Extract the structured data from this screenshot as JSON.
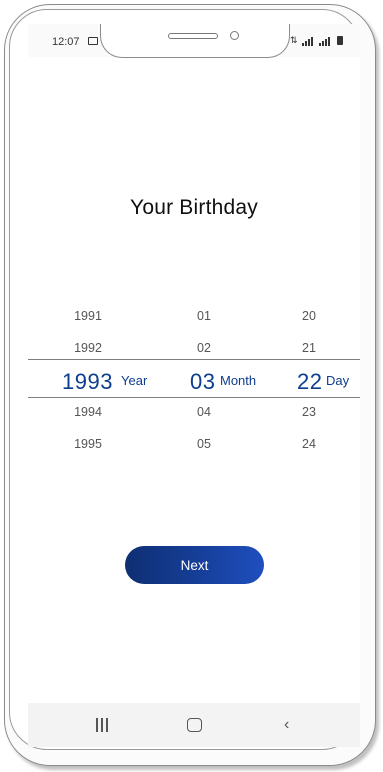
{
  "status_bar": {
    "time": "12:07",
    "icons": [
      "gallery-icon",
      "data-icon",
      "signal-icon",
      "signal-icon",
      "battery-icon"
    ]
  },
  "title": "Your Birthday",
  "picker": {
    "year": {
      "above": [
        "1991",
        "1992"
      ],
      "selected": "1993",
      "unit": "Year",
      "below": [
        "1994",
        "1995"
      ]
    },
    "month": {
      "above": [
        "01",
        "02"
      ],
      "selected": "03",
      "unit": "Month",
      "below": [
        "04",
        "05"
      ]
    },
    "day": {
      "above": [
        "20",
        "21"
      ],
      "selected": "22",
      "unit": "Day",
      "below": [
        "23",
        "24"
      ]
    }
  },
  "next_button": {
    "label": "Next"
  },
  "nav_bar": {
    "items": [
      "recent-apps-icon",
      "home-icon",
      "back-icon"
    ]
  },
  "colors": {
    "accent": "#0d3d8f",
    "button_start": "#0f2f73",
    "button_end": "#1f4fbf"
  }
}
